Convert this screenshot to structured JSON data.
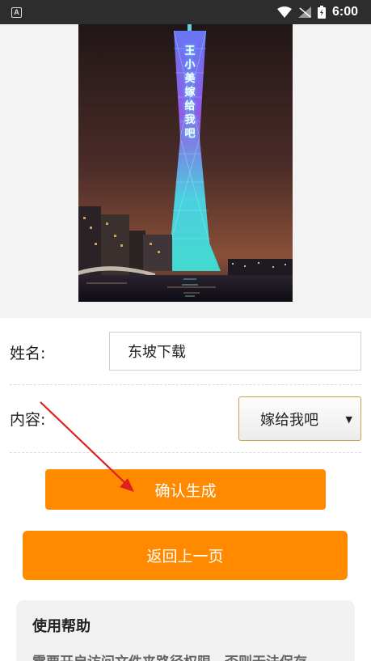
{
  "status_bar": {
    "notification_label": "A",
    "time": "6:00"
  },
  "poster": {
    "tower_text": [
      "王",
      "小",
      "美",
      "嫁",
      "给",
      "我",
      "吧"
    ]
  },
  "form": {
    "name_label": "姓名:",
    "name_value": "东坡下载",
    "content_label": "内容:",
    "content_selected": "嫁给我吧",
    "confirm_button": "确认生成",
    "back_button": "返回上一页"
  },
  "help": {
    "title": "使用帮助",
    "text": "需要开启访问文件夹路径权限，否则无法保存"
  },
  "colors": {
    "accent": "#ff8a00",
    "annotation_arrow": "#e02020"
  }
}
